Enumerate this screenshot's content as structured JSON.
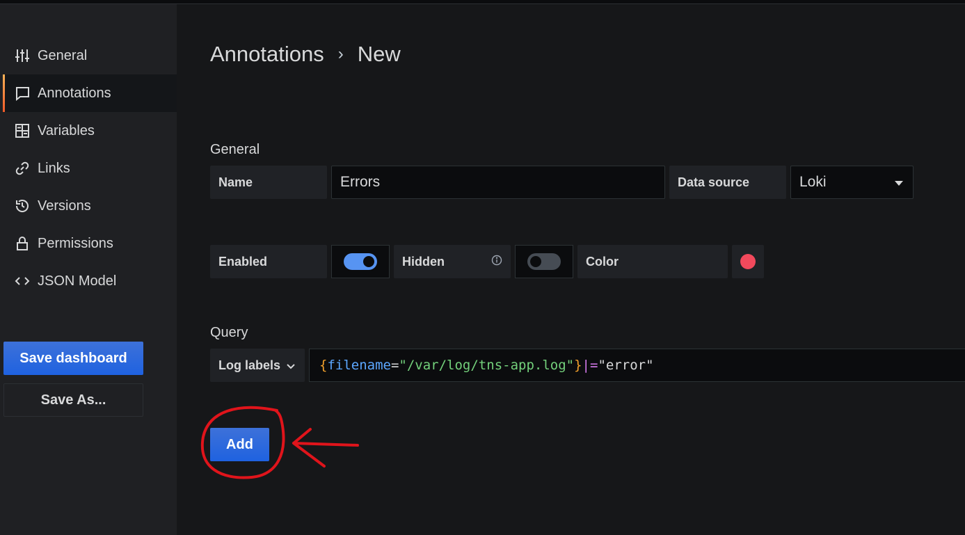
{
  "sidebar": {
    "items": [
      {
        "label": "General",
        "icon": "sliders-icon"
      },
      {
        "label": "Annotations",
        "icon": "comment-icon"
      },
      {
        "label": "Variables",
        "icon": "calculator-icon"
      },
      {
        "label": "Links",
        "icon": "link-icon"
      },
      {
        "label": "Versions",
        "icon": "history-icon"
      },
      {
        "label": "Permissions",
        "icon": "lock-icon"
      },
      {
        "label": "JSON Model",
        "icon": "code-icon"
      }
    ],
    "active": "Annotations",
    "save_dashboard": "Save dashboard",
    "save_as": "Save As..."
  },
  "breadcrumb": {
    "parent": "Annotations",
    "separator": "›",
    "current": "New"
  },
  "general": {
    "title": "General",
    "name_label": "Name",
    "name_value": "Errors",
    "datasource_label": "Data source",
    "datasource_value": "Loki",
    "enabled_label": "Enabled",
    "enabled": true,
    "hidden_label": "Hidden",
    "hidden": false,
    "color_label": "Color",
    "color_value": "#f2495c"
  },
  "query": {
    "title": "Query",
    "log_labels": "Log labels",
    "tokens": {
      "open": "{",
      "key": "filename",
      "eq": "=",
      "value": "\"/var/log/tns-app.log\"",
      "close": "}",
      "pipe": "|=",
      "filter": "\"error\""
    }
  },
  "add_button": "Add",
  "colors": {
    "accent": "#3d71d9",
    "annotation_marker": "#e0141b"
  }
}
